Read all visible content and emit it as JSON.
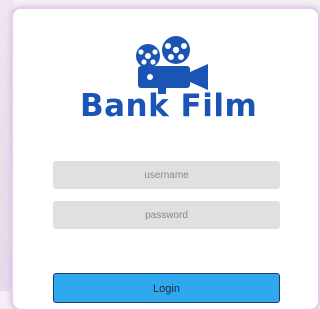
{
  "brand": {
    "name": "Bank Film",
    "logo_icon": "film-camera-icon",
    "color": "#1a54b4"
  },
  "form": {
    "username_placeholder": "username",
    "username_value": "",
    "password_placeholder": "password",
    "password_value": "",
    "login_label": "Login"
  },
  "colors": {
    "button": "#2fa8ee",
    "field": "#e1dfdf",
    "card_glow": "#d8b8de"
  }
}
